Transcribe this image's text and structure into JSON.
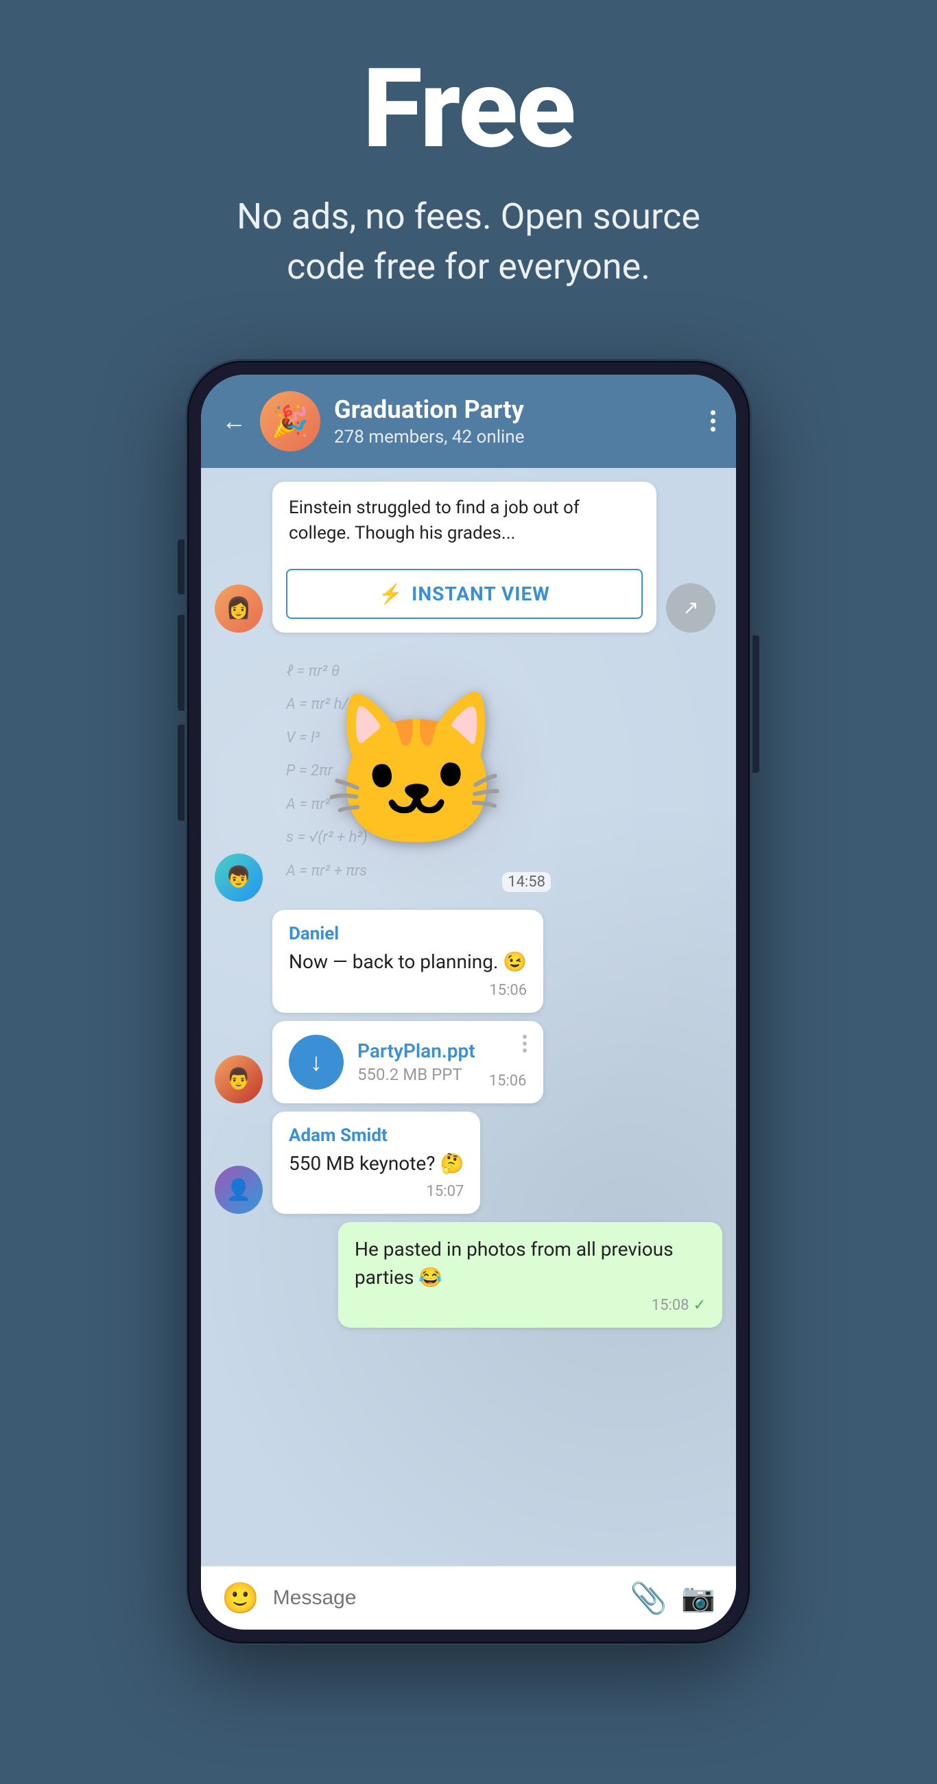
{
  "hero": {
    "title": "Free",
    "subtitle": "No ads, no fees. Open source code free for everyone."
  },
  "phone": {
    "chat": {
      "name": "Graduation Party",
      "members": "278 members, 42 online"
    },
    "messages": [
      {
        "id": "article-msg",
        "type": "article",
        "text": "Einstein struggled to find a job out of college. Though his grades...",
        "instant_view_label": "INSTANT VIEW",
        "time": ""
      },
      {
        "id": "sticker-msg",
        "type": "sticker",
        "time": "14:58"
      },
      {
        "id": "daniel-msg",
        "type": "text",
        "sender": "Daniel",
        "text": "Now — back to planning. 😉",
        "time": "15:06"
      },
      {
        "id": "file-msg",
        "type": "file",
        "filename": "PartyPlan.ppt",
        "filesize": "550.2 MB PPT",
        "time": "15:06"
      },
      {
        "id": "adam-msg",
        "type": "text",
        "sender": "Adam Smidt",
        "text": "550 MB keynote? 🤔",
        "time": "15:07"
      },
      {
        "id": "my-msg",
        "type": "outgoing",
        "text": "He pasted in photos from all previous parties 😂",
        "time": "15:08"
      }
    ],
    "input": {
      "placeholder": "Message"
    },
    "buttons": {
      "back": "←",
      "more": "⋮",
      "instant_view": "⚡ INSTANT VIEW",
      "share": "↗"
    }
  }
}
